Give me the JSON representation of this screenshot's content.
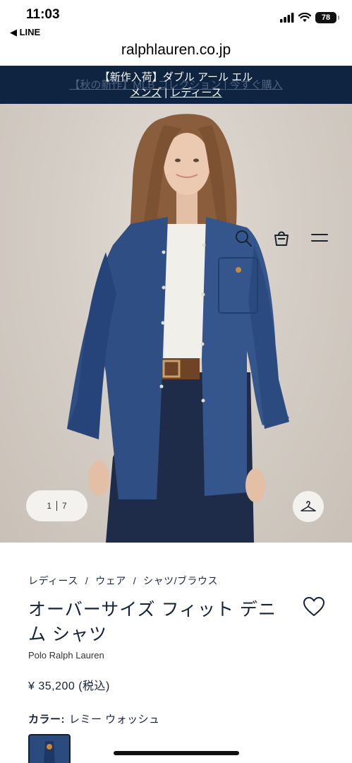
{
  "status_bar": {
    "time": "11:03",
    "back_app": "◀ LINE",
    "battery": "78"
  },
  "browser": {
    "url": "ralphlauren.co.jp"
  },
  "promo": {
    "ghost_text": "【秋の新作】MLB コレクション | 今すぐ購入",
    "line1": "【新作入荷】ダブル アール エル",
    "link_mens": "メンズ",
    "separator": "|",
    "link_ladies": "レディース"
  },
  "gallery": {
    "current": "1",
    "total": "7"
  },
  "breadcrumb": {
    "items": [
      "レディース",
      "ウェア",
      "シャツ/ブラウス"
    ],
    "separator": "/"
  },
  "product": {
    "title": "オーバーサイズ フィット デニム シャツ",
    "brand": "Polo Ralph Lauren",
    "price": "¥ 35,200 (税込)",
    "color_label": "カラー:",
    "color_value": "レミー ウォッシュ"
  },
  "colors": {
    "banner_bg": "#0e2440",
    "text_primary": "#14213a",
    "denim": "#2b4a7e"
  },
  "icons": [
    "search-icon",
    "shopping-bag-icon",
    "menu-icon",
    "hanger-icon",
    "heart-icon",
    "signal-icon",
    "wifi-icon",
    "battery-icon"
  ]
}
